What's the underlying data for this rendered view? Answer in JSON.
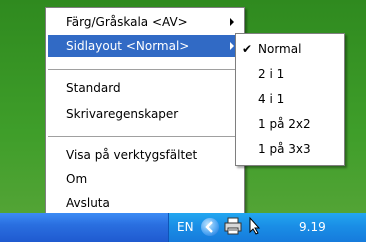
{
  "menu": {
    "items": [
      {
        "label": "Färg/Gråskala <AV>",
        "has_submenu": true
      },
      {
        "label": "Sidlayout <Normal>",
        "has_submenu": true,
        "highlighted": true
      },
      {
        "label": "Standard"
      },
      {
        "label": "Skrivaregenskaper"
      },
      {
        "label": "Visa på verktygsfältet"
      },
      {
        "label": "Om"
      },
      {
        "label": "Avsluta"
      }
    ]
  },
  "submenu": {
    "items": [
      {
        "label": "Normal",
        "checked": true
      },
      {
        "label": "2 i 1"
      },
      {
        "label": "4 i 1"
      },
      {
        "label": "1 på 2x2"
      },
      {
        "label": "1 på 3x3"
      }
    ],
    "check_glyph": "✔"
  },
  "taskbar": {
    "language": "EN",
    "clock": "9.19"
  },
  "colors": {
    "highlight": "#316ac5",
    "desktop": "#3f9e2a",
    "taskbar": "#2a6fe0",
    "tray": "#1a8ee6"
  }
}
